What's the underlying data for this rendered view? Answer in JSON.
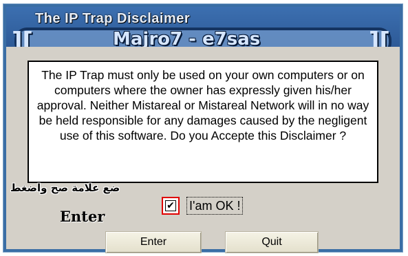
{
  "window": {
    "title": "The IP Trap Disclaimer",
    "brand_overlay": "Majro7 - e7sas",
    "bracket_left": "][",
    "bracket_right": "]["
  },
  "disclaimer": {
    "text": "The IP Trap must only be used on your own computers or on computers where the owner has expressly given his/her approval. Neither Mistareal or Mistareal Network will in no way be held responsible for any damages caused by the negligent use of this software. Do you Accepte this Disclaimer ?"
  },
  "annotation": {
    "arabic": "ضع علامة صح واضغط",
    "english": "Enter"
  },
  "checkbox": {
    "checked": true,
    "mark": "✔",
    "label": "I'am OK !"
  },
  "buttons": {
    "enter_label": "Enter",
    "quit_label": "Quit"
  },
  "colors": {
    "title_bg": "#3c6fb0",
    "highlight_border": "#e00000",
    "client_bg": "#d4d0c8"
  }
}
